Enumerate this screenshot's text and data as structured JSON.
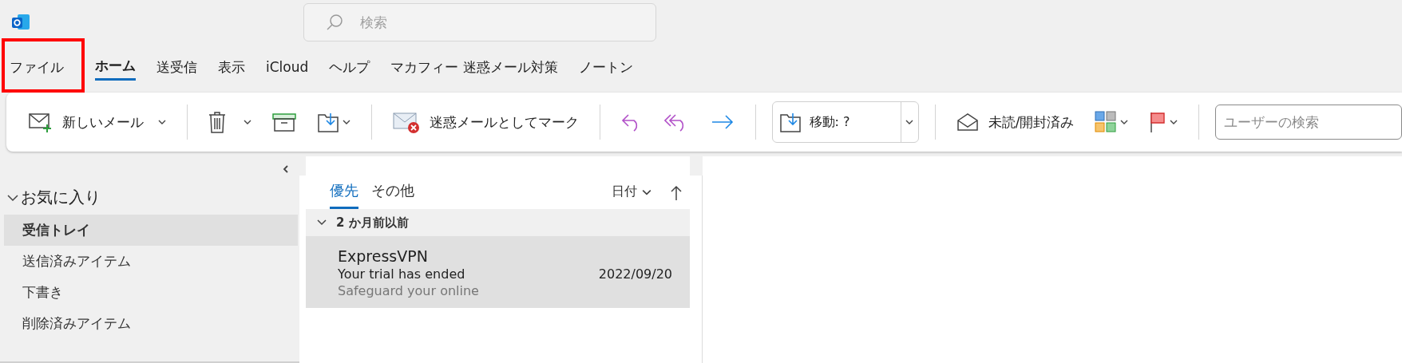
{
  "title_bar": {
    "search_placeholder": "検索"
  },
  "menu_tabs": [
    {
      "label": "ファイル",
      "selected": false,
      "highlighted": true
    },
    {
      "label": "ホーム",
      "selected": true,
      "highlighted": false
    },
    {
      "label": "送受信",
      "selected": false,
      "highlighted": false
    },
    {
      "label": "表示",
      "selected": false,
      "highlighted": false
    },
    {
      "label": "iCloud",
      "selected": false,
      "highlighted": false
    },
    {
      "label": "ヘルプ",
      "selected": false,
      "highlighted": false
    },
    {
      "label": "マカフィー 迷惑メール対策",
      "selected": false,
      "highlighted": false
    },
    {
      "label": "ノートン",
      "selected": false,
      "highlighted": false
    }
  ],
  "ribbon": [
    {
      "kind": "new_mail",
      "label": "新しいメール"
    },
    {
      "kind": "separator"
    },
    {
      "kind": "delete"
    },
    {
      "kind": "archive"
    },
    {
      "kind": "move"
    },
    {
      "kind": "separator"
    },
    {
      "kind": "junk",
      "label": "迷惑メールとしてマーク"
    },
    {
      "kind": "separator"
    },
    {
      "kind": "reply"
    },
    {
      "kind": "reply_all"
    },
    {
      "kind": "forward"
    },
    {
      "kind": "separator"
    },
    {
      "kind": "move_combo",
      "label": "移動: ?"
    },
    {
      "kind": "separator"
    },
    {
      "kind": "read_unread",
      "label": "未読/開封済み"
    },
    {
      "kind": "categorize"
    },
    {
      "kind": "flag"
    },
    {
      "kind": "separator"
    },
    {
      "kind": "people_search",
      "placeholder": "ユーザーの検索"
    }
  ],
  "folders": {
    "title": "お気に入り",
    "expanded": true,
    "items": [
      {
        "label": "受信トレイ",
        "selected": true
      },
      {
        "label": "送信済みアイテム",
        "selected": false
      },
      {
        "label": "下書き",
        "selected": false
      },
      {
        "label": "削除済みアイテム",
        "selected": false
      }
    ]
  },
  "message_list": {
    "tabs": [
      {
        "label": "優先",
        "selected": true
      },
      {
        "label": "その他",
        "selected": false
      }
    ],
    "sort": "日付",
    "groups": [
      {
        "label": "2 か月前以前",
        "expanded": true,
        "messages": [
          {
            "sender": "ExpressVPN",
            "subject": "Your trial has ended",
            "date": "2022/09/20",
            "preview": "Safeguard your online",
            "selected": true
          }
        ]
      }
    ]
  }
}
